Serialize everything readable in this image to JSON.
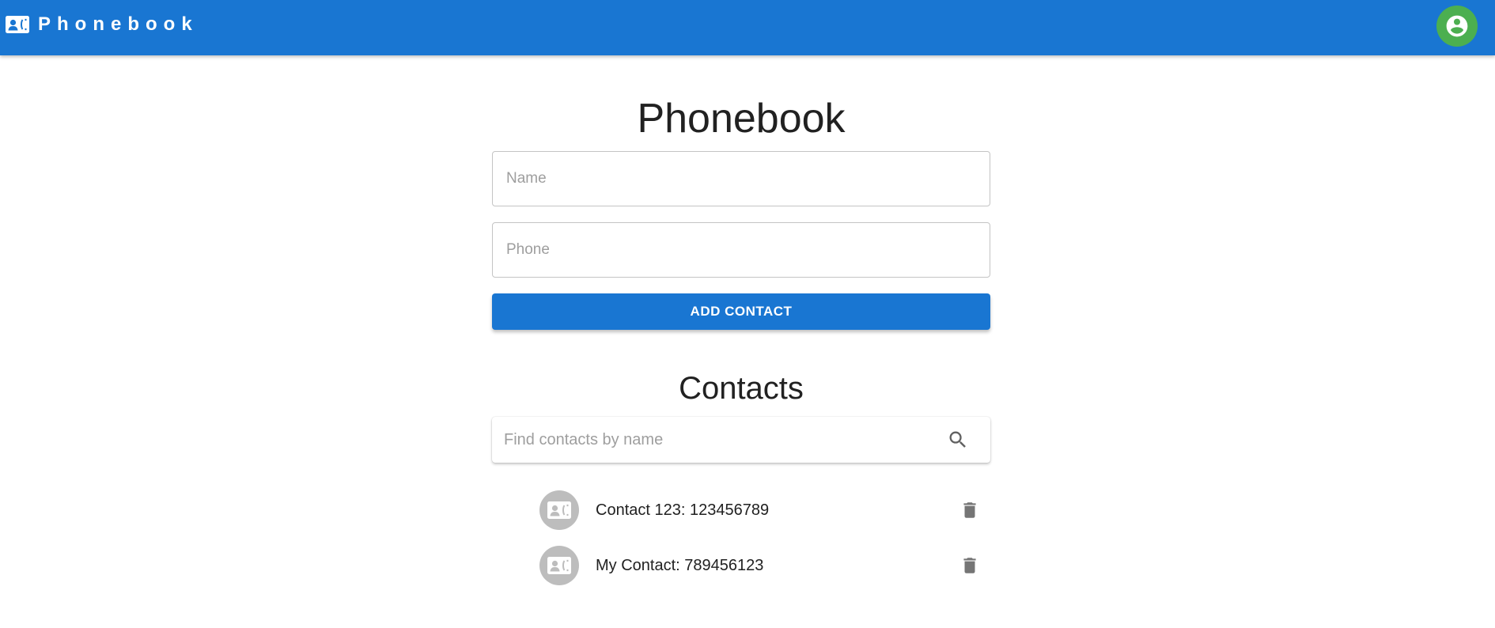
{
  "appbar": {
    "brand_icon": "contact-card-icon",
    "title": "Phonebook",
    "account_icon": "account-circle-icon",
    "color": "#1976d2",
    "account_color": "#4caf50"
  },
  "form": {
    "title": "Phonebook",
    "name_placeholder": "Name",
    "name_value": "",
    "phone_placeholder": "Phone",
    "phone_value": "",
    "submit_label": "ADD CONTACT"
  },
  "contacts": {
    "title": "Contacts",
    "search_placeholder": "Find contacts by name",
    "search_icon": "search-icon",
    "items": [
      {
        "label": "Contact 123: 123456789",
        "avatar_icon": "contact-card-icon",
        "delete_icon": "trash-icon"
      },
      {
        "label": "My Contact: 789456123",
        "avatar_icon": "contact-card-icon",
        "delete_icon": "trash-icon"
      }
    ]
  }
}
